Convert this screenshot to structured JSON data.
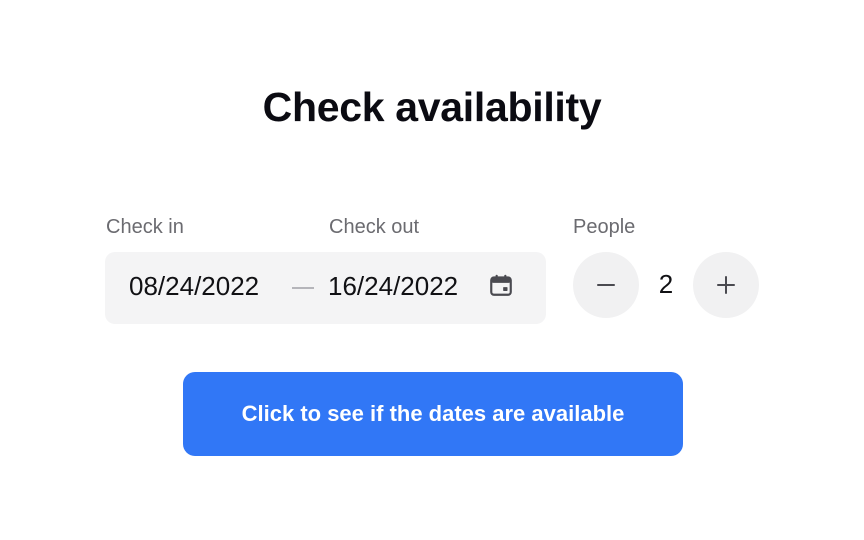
{
  "heading": "Check availability",
  "colors": {
    "primary": "#3177f6",
    "field_bg": "#f4f4f5",
    "label": "#6b6b70",
    "text": "#111114"
  },
  "check_in": {
    "label": "Check in",
    "value": "08/24/2022"
  },
  "check_out": {
    "label": "Check out",
    "value": "16/24/2022"
  },
  "date_range": {
    "icon": "calendar-icon"
  },
  "people": {
    "label": "People",
    "count": "2",
    "decrement_icon": "minus-icon",
    "increment_icon": "plus-icon"
  },
  "cta": {
    "label": "Click to see if the dates are available"
  }
}
